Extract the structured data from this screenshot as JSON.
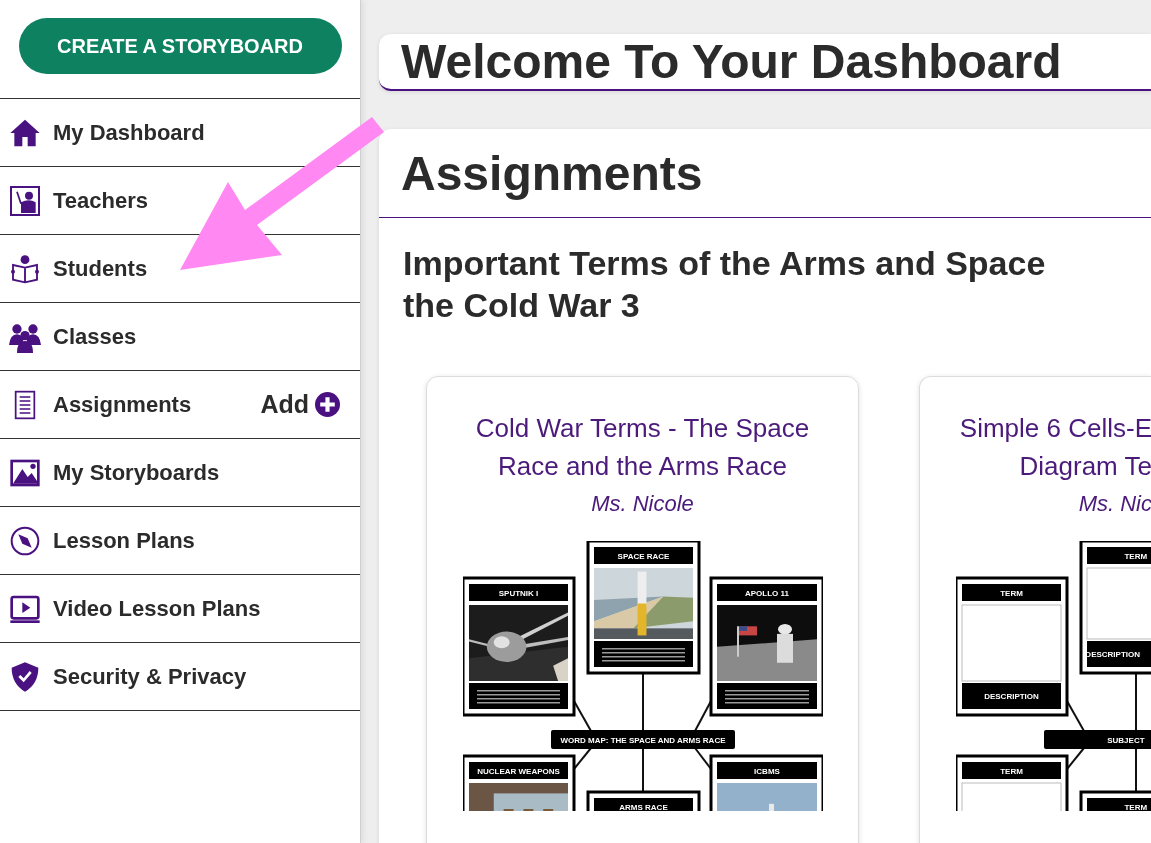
{
  "sidebar": {
    "create_button": "CREATE A STORYBOARD",
    "items": [
      {
        "label": "My Dashboard"
      },
      {
        "label": "Teachers"
      },
      {
        "label": "Students"
      },
      {
        "label": "Classes"
      },
      {
        "label": "Assignments",
        "action": "Add"
      },
      {
        "label": "My Storyboards"
      },
      {
        "label": "Lesson Plans"
      },
      {
        "label": "Video Lesson Plans"
      },
      {
        "label": "Security & Privacy"
      }
    ]
  },
  "welcome": {
    "title": "Welcome To Your Dashboard"
  },
  "assignments": {
    "title": "Assignments",
    "assignment_title_lines": [
      "Important Terms of the Arms and Space",
      "the Cold War 3"
    ],
    "storyboards": [
      {
        "title_lines": [
          "Cold War Terms - The Space",
          "Race and the Arms Race"
        ],
        "author": "Ms. Nicole",
        "cut": false,
        "center": "WORD MAP: THE SPACE AND ARMS RACE",
        "cells": [
          {
            "header": "SPACE RACE",
            "caption": true
          },
          {
            "header": "SPUTNIK I",
            "caption": true
          },
          {
            "header": "NUCLEAR WEAPONS"
          },
          {
            "header": "ARMS RACE"
          },
          {
            "header": "APOLLO 11",
            "caption": true
          },
          {
            "header": "ICBMS"
          }
        ]
      },
      {
        "title_lines": [
          "Simple 6 Cells-E",
          "Diagram Te"
        ],
        "author": "Ms. Nic",
        "cut": true,
        "center": "SUBJECT",
        "cells": [
          {
            "header": "TERM",
            "kind": "blank",
            "footer": "DESCRIPTION"
          },
          {
            "header": "TERM",
            "kind": "blank",
            "footer": "DESCRIPTION"
          },
          {
            "header": "TERM",
            "kind": "blank"
          },
          {
            "header": "TERM",
            "kind": "blank"
          }
        ]
      }
    ]
  }
}
